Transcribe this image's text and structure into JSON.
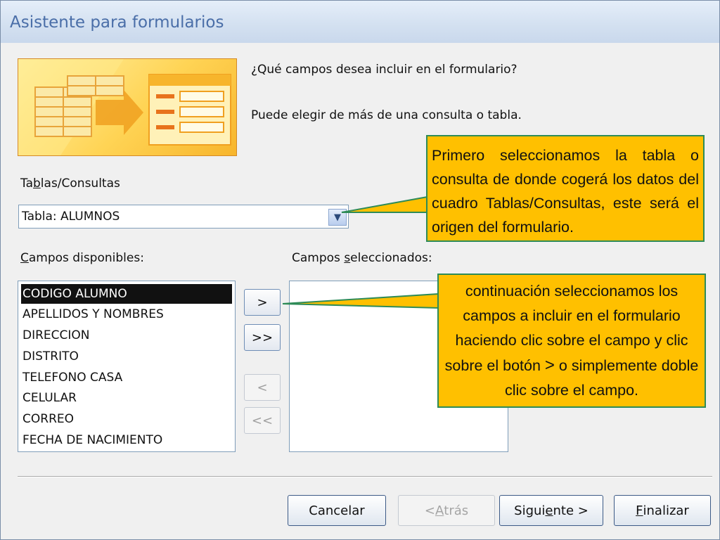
{
  "window": {
    "title": "Asistente para formularios"
  },
  "banner": {
    "icon": "table-to-form-icon"
  },
  "questions": {
    "q1": "¿Qué campos desea incluir en el formulario?",
    "q2": "Puede elegir de más de una consulta o tabla."
  },
  "tables": {
    "label_pre": "Ta",
    "label_u": "b",
    "label_post": "las/Consultas",
    "value": "Tabla: ALUMNOS"
  },
  "available": {
    "label_u": "C",
    "label_post": "ampos disponibles:",
    "items": [
      "CODIGO ALUMNO",
      "APELLIDOS Y NOMBRES",
      "DIRECCION",
      "DISTRITO",
      "TELEFONO CASA",
      "CELULAR",
      "CORREO",
      "FECHA DE NACIMIENTO"
    ],
    "selected_index": 0
  },
  "selected": {
    "label_pre": "Campos ",
    "label_u": "s",
    "label_post": "eleccionados:",
    "items": []
  },
  "move_buttons": {
    "add": ">",
    "add_all": ">>",
    "remove": "<",
    "remove_all": "<<"
  },
  "footer": {
    "cancel": "Cancelar",
    "back_pre": "< ",
    "back_u": "A",
    "back_post": "trás",
    "next_pre": "Sigui",
    "next_u": "e",
    "next_post": "nte >",
    "finish_u": "F",
    "finish_post": "inalizar"
  },
  "callouts": {
    "c1": "Primero seleccionamos la tabla o consulta de donde cogerá los datos del cuadro Tablas/Consultas, este será el origen del formulario.",
    "c2_a": "continuación seleccionamos los campos a incluir en el formulario haciendo clic sobre el campo y clic sobre el botón",
    "c2_sym": ">",
    "c2_b": "o simplemente doble clic sobre el campo."
  },
  "colors": {
    "callout_fill": "#ffc000",
    "callout_border": "#2e8b57",
    "title_text": "#4a6ea8"
  }
}
